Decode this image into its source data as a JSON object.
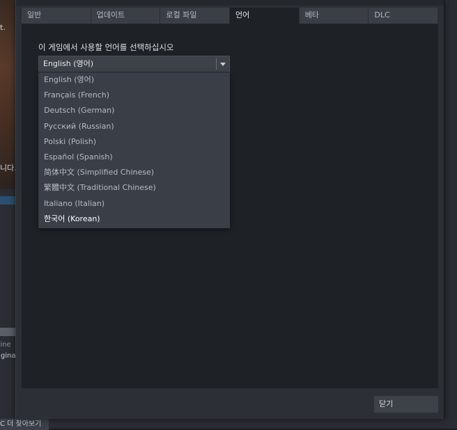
{
  "background": {
    "fragment_top": "t.",
    "fragment_mid": "니다.",
    "fragment_engine": "gine",
    "fragment_original": "rigina",
    "bottom_tab": "C 더 찾아보기"
  },
  "tabs": [
    {
      "label": "일반"
    },
    {
      "label": "업데이트"
    },
    {
      "label": "로컬 파일"
    },
    {
      "label": "언어"
    },
    {
      "label": "베타"
    },
    {
      "label": "DLC"
    }
  ],
  "language": {
    "prompt": "이 게임에서 사용할 언어를 선택하십시오",
    "selected": "English (영어)",
    "options": [
      "English (영어)",
      "Français (French)",
      "Deutsch (German)",
      "Русский (Russian)",
      "Polski (Polish)",
      "Español (Spanish)",
      "简体中文 (Simplified Chinese)",
      "繁體中文 (Traditional Chinese)",
      "Italiano (Italian)",
      "한국어 (Korean)"
    ]
  },
  "footer": {
    "close_label": "닫기"
  },
  "colors": {
    "dialog_bg": "#2c2f35",
    "content_bg": "#1e2126",
    "active_tab_bg": "#1e2126",
    "tab_bg": "#3a3e45",
    "dropdown_bg": "#3a3e46"
  }
}
